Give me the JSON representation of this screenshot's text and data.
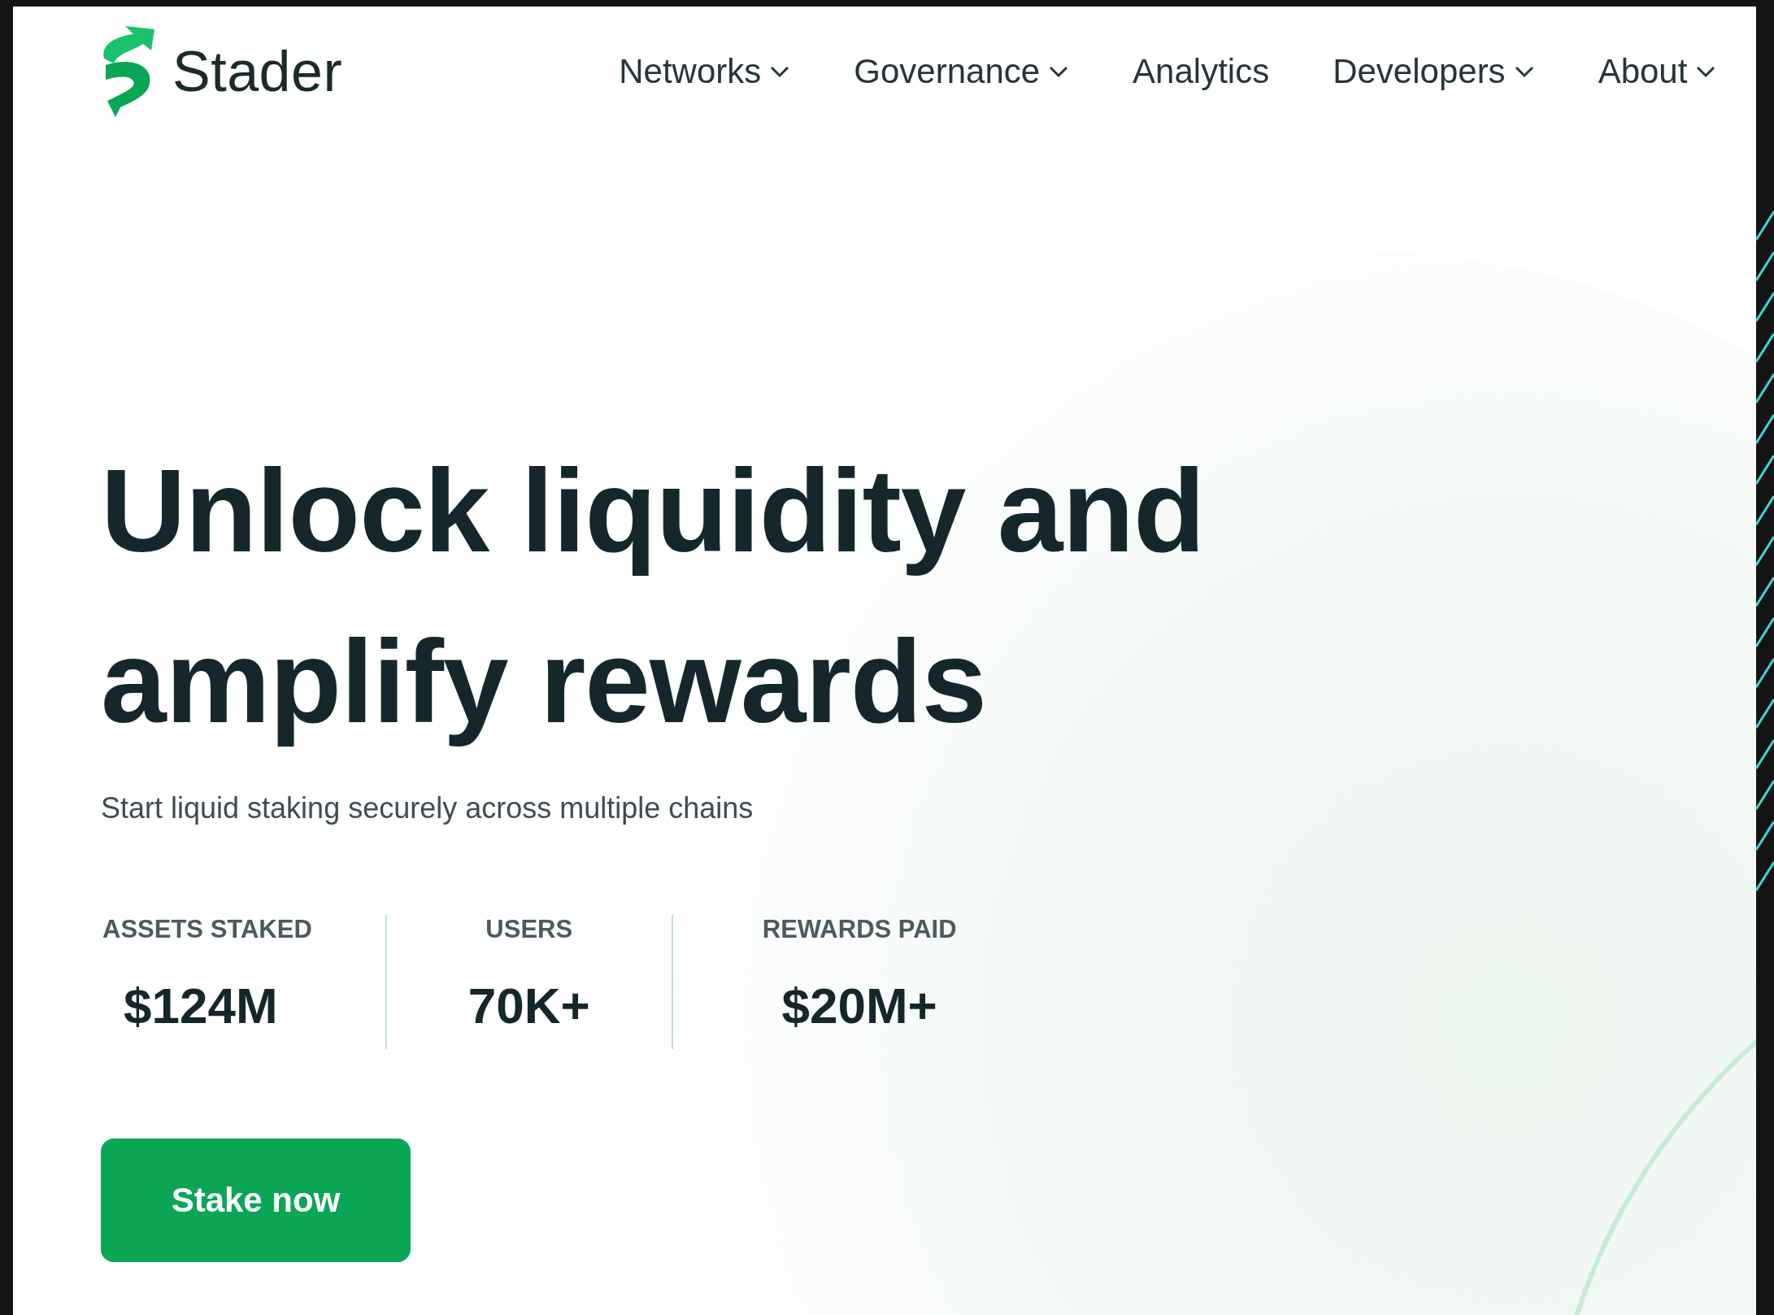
{
  "logo": {
    "text": "Stader"
  },
  "nav": [
    {
      "label": "Networks",
      "dropdown": true
    },
    {
      "label": "Governance",
      "dropdown": true
    },
    {
      "label": "Analytics",
      "dropdown": false
    },
    {
      "label": "Developers",
      "dropdown": true
    },
    {
      "label": "About",
      "dropdown": true
    }
  ],
  "hero": {
    "title_lines": [
      "Unlock liquidity and",
      "amplify rewards"
    ],
    "subtitle": "Start liquid staking securely across multiple chains",
    "stats": [
      {
        "label": "ASSETS STAKED",
        "value": "$124M"
      },
      {
        "label": "USERS",
        "value": "70K+"
      },
      {
        "label": "REWARDS PAID",
        "value": "$20M+"
      }
    ],
    "cta": "Stake now"
  }
}
